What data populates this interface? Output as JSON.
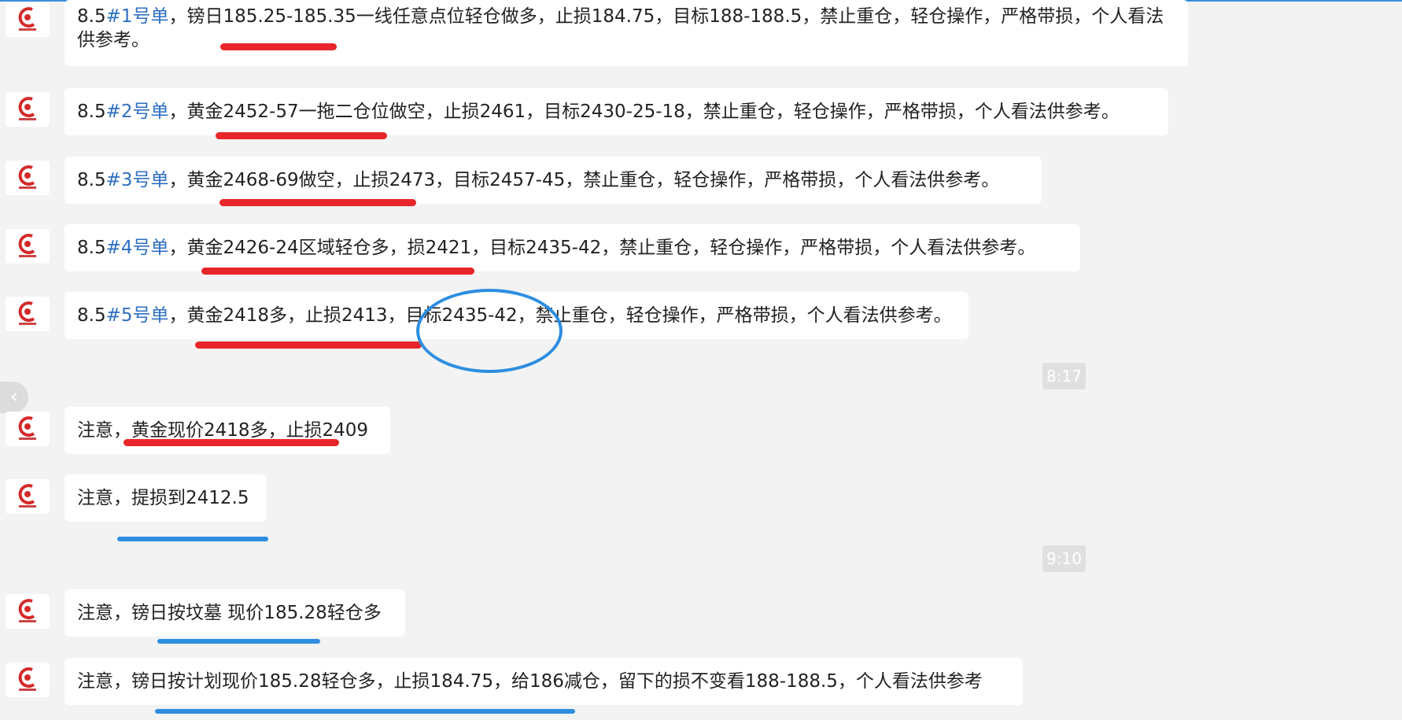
{
  "messages": [
    {
      "tag": "8.5",
      "tag2": "#1号单",
      "text": "，镑日185.25-185.35一线任意点位轻仓做多，止损184.75，目标188-188.5，禁止重仓，轻仓操作，严格带损，个人看法供参考。"
    },
    {
      "tag": "8.5",
      "tag2": "#2号单",
      "text": "，黄金2452-57一拖二仓位做空，止损2461，目标2430-25-18，禁止重仓，轻仓操作，严格带损，个人看法供参考。"
    },
    {
      "tag": "8.5",
      "tag2": "#3号单",
      "text": "，黄金2468-69做空，止损2473，目标2457-45，禁止重仓，轻仓操作，严格带损，个人看法供参考。"
    },
    {
      "tag": "8.5",
      "tag2": "#4号单",
      "text": "，黄金2426-24区域轻仓多，损2421，目标2435-42，禁止重仓，轻仓操作，严格带损，个人看法供参考。"
    },
    {
      "tag": "8.5",
      "tag2": "#5号单",
      "text": "，黄金2418多，止损2413，目标2435-42，禁止重仓，轻仓操作，严格带损，个人看法供参考。"
    },
    {
      "text": "注意，黄金现价2418多，止损2409"
    },
    {
      "text": "注意，提损到2412.5"
    },
    {
      "text": "注意，镑日按坟墓 现价185.28轻仓多"
    },
    {
      "text": "注意，镑日按计划现价185.28轻仓多，止损184.75，给186减仓，留下的损不变看188-188.5，个人看法供参考"
    }
  ],
  "timestamps": [
    "8:17",
    "9:10"
  ],
  "scroll_left_icon": "chevron-left-icon",
  "avatar_icon": "brand-logo-icon",
  "colors": {
    "accent": "#2e6fc2",
    "red_mark": "#e8262a",
    "blue_mark": "#2d8ee0"
  }
}
